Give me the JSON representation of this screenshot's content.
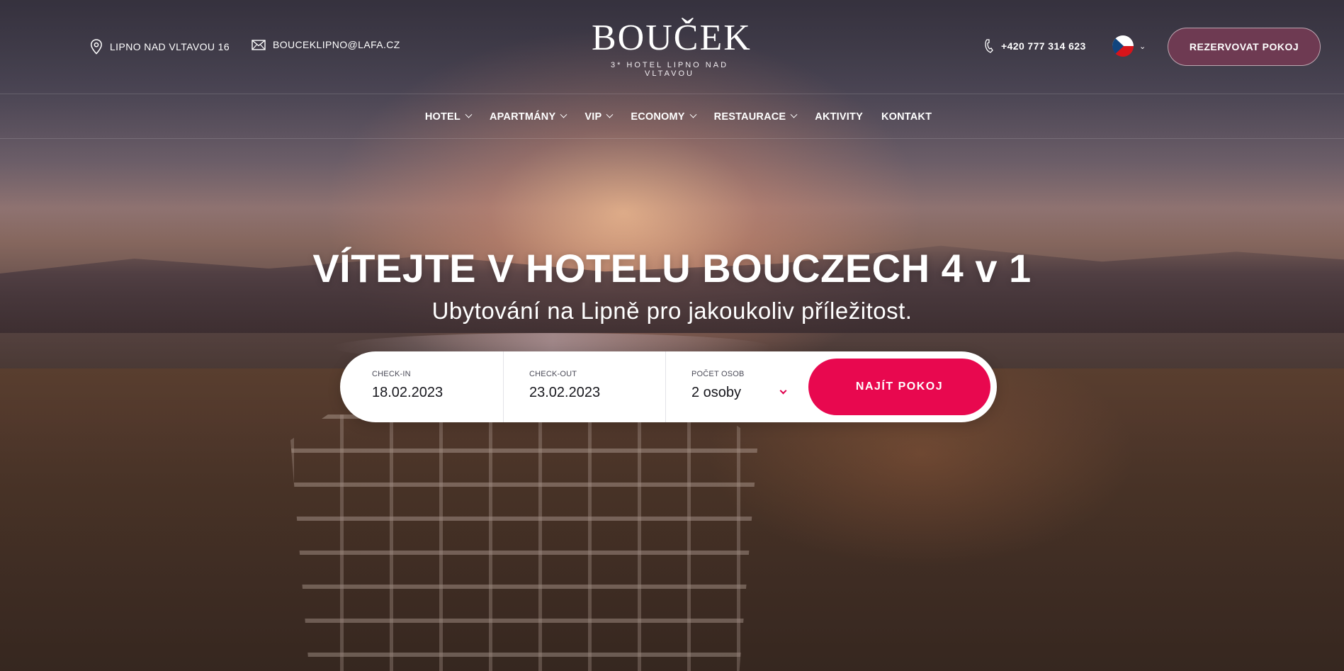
{
  "header": {
    "address": "LIPNO NAD VLTAVOU 16",
    "email": "BOUCEKLIPNO@LAFA.CZ",
    "logo_name": "BOUČEK",
    "logo_subtitle": "3* HOTEL LIPNO NAD VLTAVOU",
    "phone": "+420 777 314 623",
    "language": "cs",
    "reserve_label": "REZERVOVAT POKOJ",
    "icons": [
      "map-pin-icon",
      "mail-icon",
      "phone-icon",
      "flag-cz-icon",
      "chevron-down-icon"
    ]
  },
  "nav": {
    "items": [
      {
        "label": "HOTEL",
        "dropdown": true
      },
      {
        "label": "APARTMÁNY",
        "dropdown": true
      },
      {
        "label": "VIP",
        "dropdown": true
      },
      {
        "label": "ECONOMY",
        "dropdown": true
      },
      {
        "label": "RESTAURACE",
        "dropdown": true
      },
      {
        "label": "AKTIVITY",
        "dropdown": false
      },
      {
        "label": "KONTAKT",
        "dropdown": false
      }
    ]
  },
  "hero": {
    "title": "VÍTEJTE V HOTELU BOUCZECH 4 v 1",
    "subtitle": "Ubytování na Lipně pro jakoukoliv příležitost."
  },
  "booking": {
    "checkin_label": "CHECK-IN",
    "checkin_value": "18.02.2023",
    "checkout_label": "CHECK-OUT",
    "checkout_value": "23.02.2023",
    "persons_label": "POČET OSOB",
    "persons_value": "2 osoby",
    "submit_label": "NAJÍT POKOJ"
  },
  "colors": {
    "accent": "#e8084f",
    "reserve_button": "#6e3a52",
    "text_light": "#ffffff"
  }
}
